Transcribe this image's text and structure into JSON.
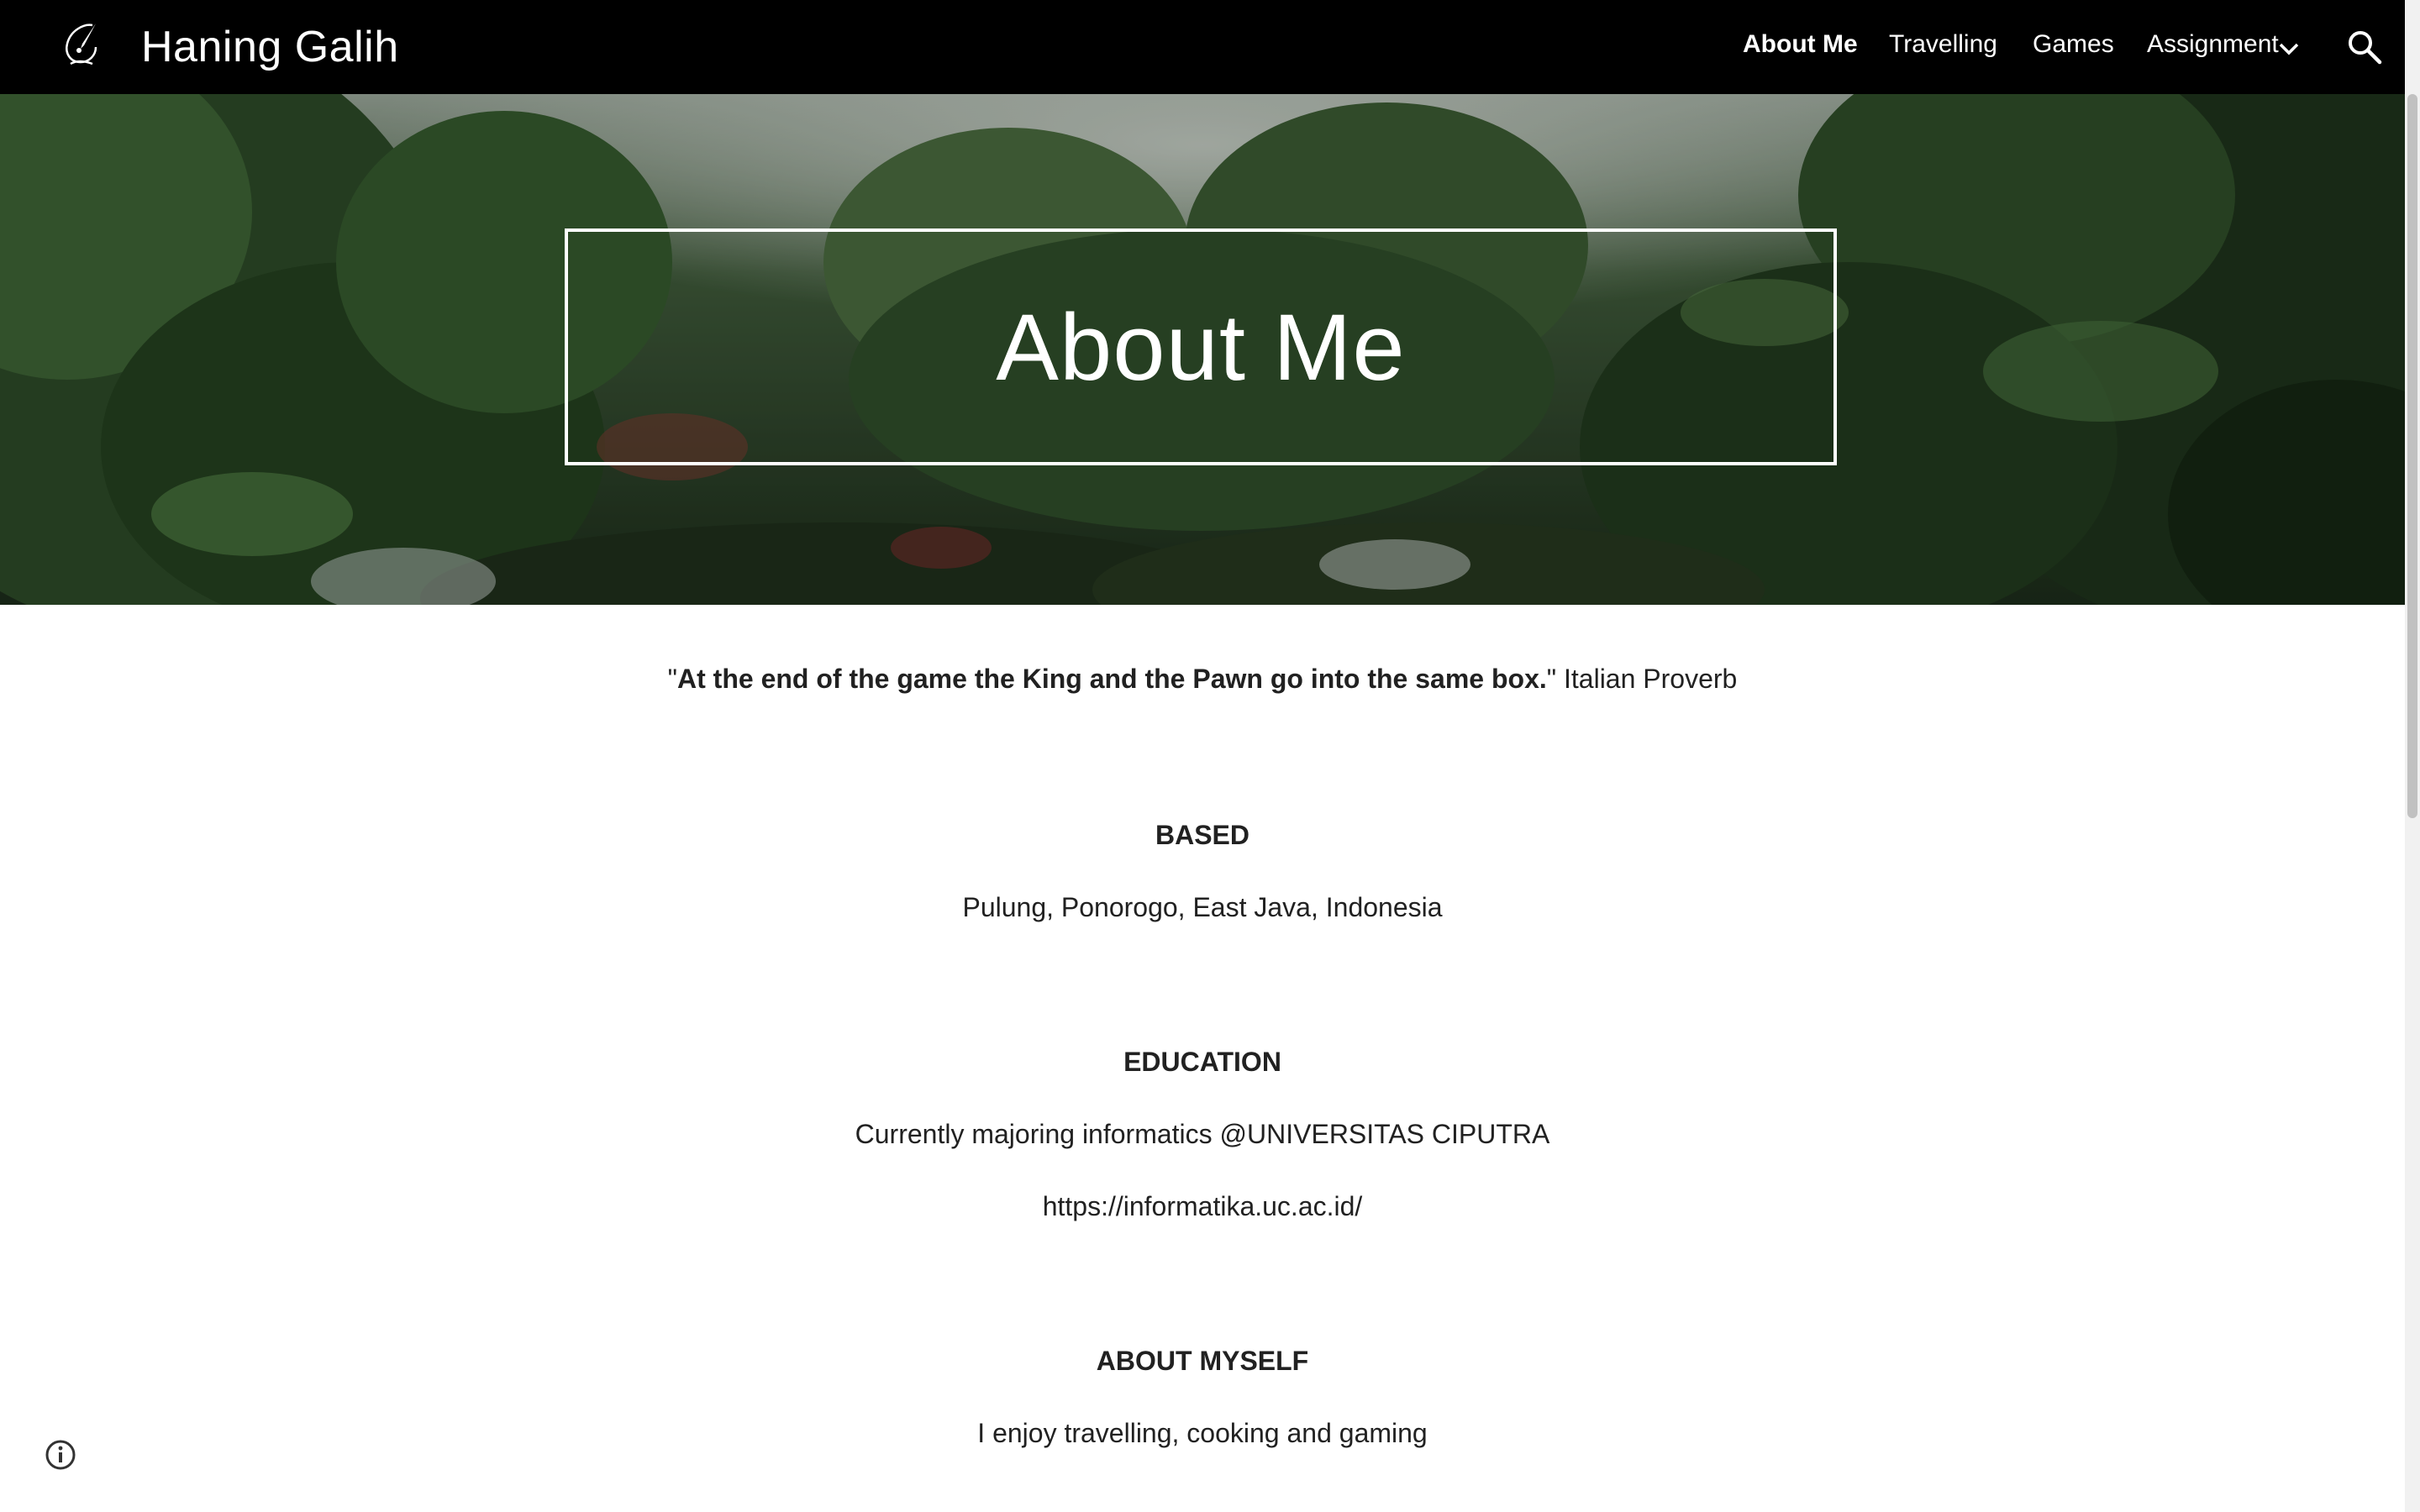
{
  "header": {
    "site_title": "Haning Galih",
    "logo_icon": "pen-logo-icon",
    "nav": [
      {
        "label": "About Me",
        "active": true
      },
      {
        "label": "Travelling",
        "active": false
      },
      {
        "label": "Games",
        "active": false
      },
      {
        "label": "Assignment",
        "active": false,
        "has_dropdown": true
      }
    ],
    "search_icon": "search-icon",
    "dropdown_icon": "chevron-down-icon"
  },
  "hero": {
    "title": "About Me",
    "background": "jungle-forest-photo"
  },
  "content": {
    "quote": {
      "open": "\"",
      "bold": "At the end of the game the King and the Pawn go into the same box.",
      "close": "\"",
      "attribution": " Italian Proverb"
    },
    "sections": [
      {
        "heading": "BASED",
        "lines": [
          "Pulung, Ponorogo, East Java, Indonesia"
        ]
      },
      {
        "heading": "EDUCATION",
        "lines": [
          "Currently majoring informatics @UNIVERSITAS CIPUTRA",
          "https://informatika.uc.ac.id/"
        ]
      },
      {
        "heading": "ABOUT MYSELF",
        "lines": [
          "I enjoy travelling, cooking and gaming"
        ]
      }
    ]
  },
  "footer": {
    "info_icon": "info-icon"
  },
  "colors": {
    "topbar": "#000000",
    "text": "#212121",
    "hero_text": "#ffffff"
  }
}
